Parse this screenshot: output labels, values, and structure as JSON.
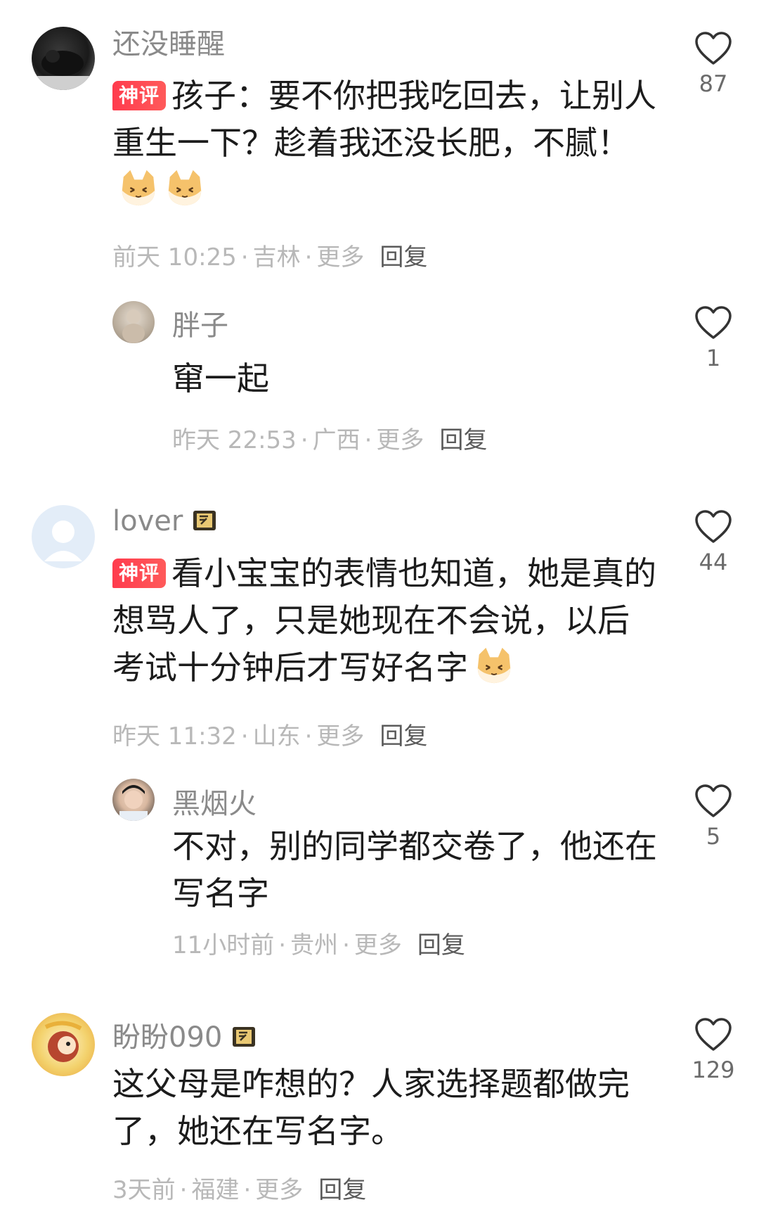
{
  "tag_hot": "神评",
  "comments": [
    {
      "user": "还没睡醒",
      "tag": "神评",
      "text": "孩子：要不你把我吃回去，让别人重生一下？趁着我还没长肥，不腻！",
      "time": "前天 10:25",
      "location": "吉林",
      "more": "更多",
      "reply": "回复",
      "likes": "87",
      "replies": [
        {
          "user": "胖子",
          "text": "窜一起",
          "time": "昨天 22:53",
          "location": "广西",
          "more": "更多",
          "reply": "回复",
          "likes": "1"
        }
      ]
    },
    {
      "user": "lover",
      "tag": "神评",
      "text": "看小宝宝的表情也知道，她是真的想骂人了，只是她现在不会说，以后考试十分钟后才写好名字",
      "time": "昨天 11:32",
      "location": "山东",
      "more": "更多",
      "reply": "回复",
      "likes": "44",
      "replies": [
        {
          "user": "黑烟火",
          "text": "不对，别的同学都交卷了，他还在写名字",
          "time": "11小时前",
          "location": "贵州",
          "more": "更多",
          "reply": "回复",
          "likes": "5"
        }
      ]
    },
    {
      "user": "盼盼090",
      "text": "这父母是咋想的？人家选择题都做完了，她还在写名字。",
      "time": "3天前",
      "location": "福建",
      "more": "更多",
      "reply": "回复",
      "likes": "129"
    }
  ],
  "icons": {
    "like": "heart-outline-icon",
    "badge": "scroll-badge-icon",
    "emoji": "cat-face-emoji"
  }
}
